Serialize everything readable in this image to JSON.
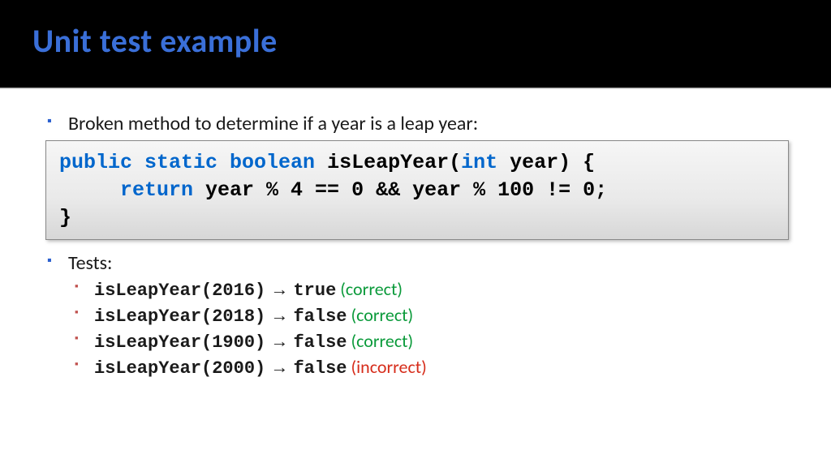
{
  "title": "Unit test example",
  "bullet1": "Broken method to determine if a year is a leap year:",
  "code": {
    "l1a": "public static boolean",
    "l1b": " isLeapYear(",
    "l1c": "int",
    "l1d": " year) {",
    "l2a": "     ",
    "l2b": "return",
    "l2c": " year % 4 == 0 && year % 100 != 0;",
    "l3": "}"
  },
  "bullet2": "Tests:",
  "tests": [
    {
      "call": "isLeapYear(2016)",
      "arrow": " → ",
      "result": "true",
      "note": " (correct)",
      "ok": true
    },
    {
      "call": "isLeapYear(2018)",
      "arrow": " → ",
      "result": "false",
      "note": " (correct)",
      "ok": true
    },
    {
      "call": "isLeapYear(1900)",
      "arrow": " → ",
      "result": "false",
      "note": " (correct)",
      "ok": true
    },
    {
      "call": "isLeapYear(2000)",
      "arrow": " → ",
      "result": "false",
      "note": " (incorrect)",
      "ok": false
    }
  ]
}
